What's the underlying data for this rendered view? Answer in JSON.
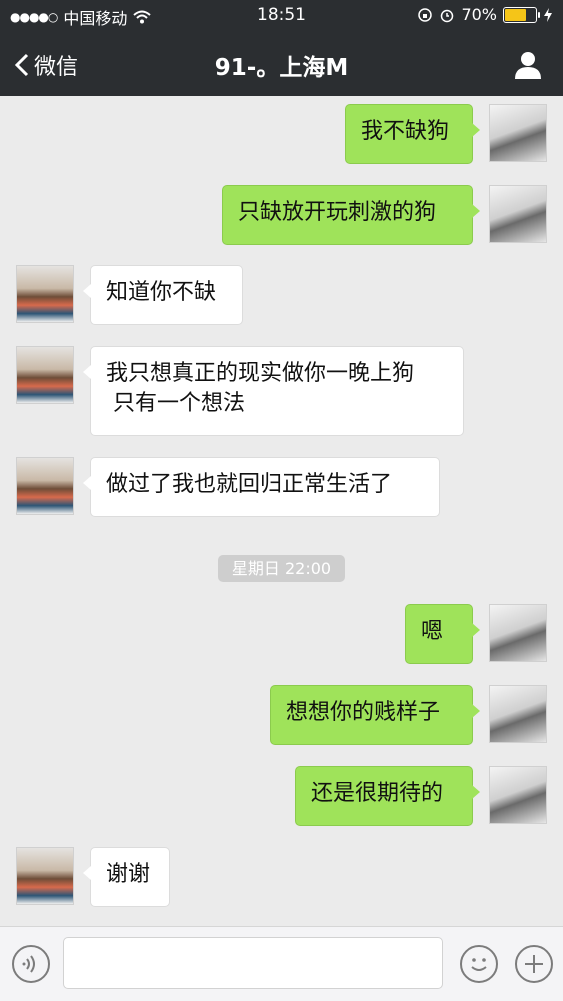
{
  "status_bar": {
    "signal": "●●●●○",
    "carrier": "中国移动",
    "time": "18:51",
    "battery_percent": 70,
    "battery_text": "70%"
  },
  "nav": {
    "back_label": "微信",
    "title": "91-。上海M"
  },
  "messages": [
    {
      "from": "me",
      "text": "我不缺狗"
    },
    {
      "from": "me",
      "text": "只缺放开玩刺激的狗"
    },
    {
      "from": "them",
      "text": "知道你不缺"
    },
    {
      "from": "them",
      "text": "我只想真正的现实做你一晚上狗\n 只有一个想法"
    },
    {
      "from": "them",
      "text": "做过了我也就回归正常生活了"
    },
    {
      "from": "me",
      "text": "嗯"
    },
    {
      "from": "me",
      "text": "想想你的贱样子"
    },
    {
      "from": "me",
      "text": "还是很期待的"
    },
    {
      "from": "them",
      "text": "谢谢"
    }
  ],
  "timestamp": "星期日 22:00",
  "colors": {
    "nav_background": "#2b2e31",
    "my_bubble": "#9fe35a",
    "their_bubble": "#ffffff",
    "chat_background": "#ebebeb",
    "battery_fill": "#f5c518"
  },
  "icons": {
    "voice": "voice-input-icon",
    "emoji": "emoji-icon",
    "more": "plus-icon",
    "profile": "person-icon",
    "back": "chevron-left-icon"
  }
}
